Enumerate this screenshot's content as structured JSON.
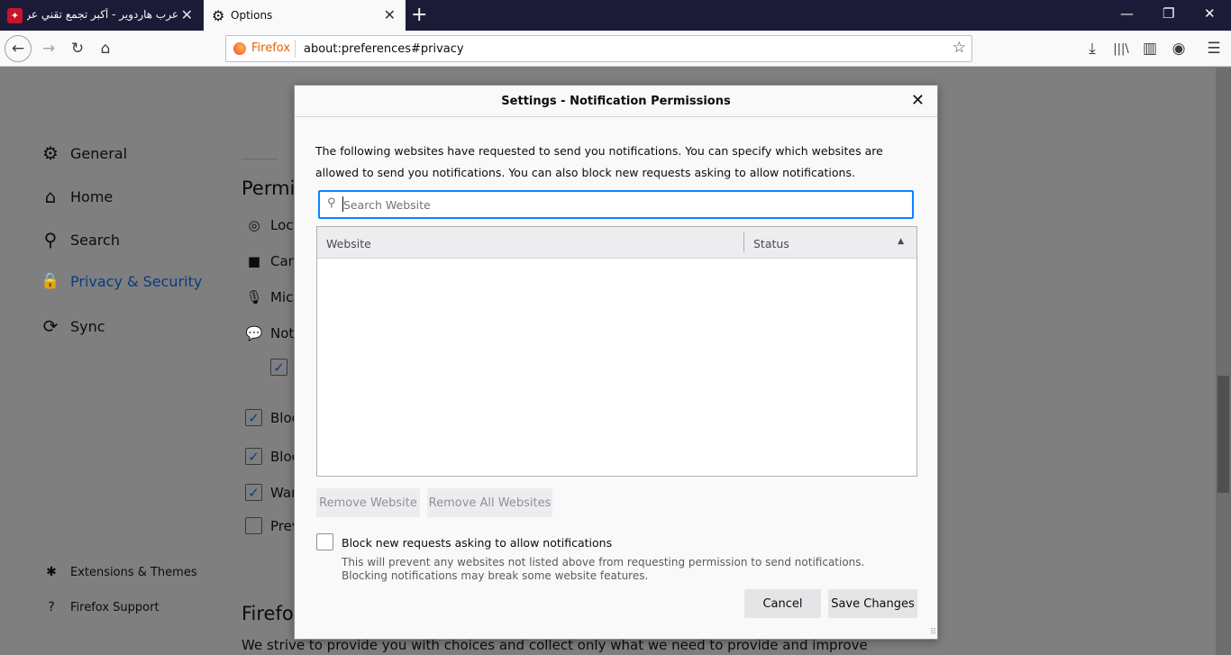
{
  "tabs": [
    {
      "title": "عرب هاردوير - أكبر تجمع تقني عربي",
      "favicon_glyph": "✦",
      "close": "✕"
    },
    {
      "title": "Options",
      "close": "✕"
    }
  ],
  "new_tab": "+",
  "window_controls": {
    "minimize": "—",
    "restore": "❐",
    "close": "✕"
  },
  "toolbar": {
    "back": "←",
    "forward": "→",
    "reload": "↻",
    "home": "⌂",
    "identity_label": "Firefox",
    "url": "about:preferences#privacy",
    "bookmark_star": "☆",
    "downloads": "⤓",
    "library": "|||\\",
    "sidebar": "▥",
    "account": "◉",
    "menu": "☰"
  },
  "sidebar": {
    "items": [
      {
        "label": "General",
        "icon": "⚙"
      },
      {
        "label": "Home",
        "icon": "⌂"
      },
      {
        "label": "Search",
        "icon": "⚲"
      },
      {
        "label": "Privacy & Security",
        "icon": "🔒"
      },
      {
        "label": "Sync",
        "icon": "⟳"
      }
    ],
    "footer": [
      {
        "label": "Extensions & Themes",
        "icon": "✱"
      },
      {
        "label": "Firefox Support",
        "icon": "?"
      }
    ]
  },
  "background_page": {
    "section_heading": "Permis",
    "permissions": [
      {
        "label": "Loca",
        "icon": "◎"
      },
      {
        "label": "Cam",
        "icon": "■"
      },
      {
        "label": "Micr",
        "icon": "🎙"
      },
      {
        "label": "Noti",
        "icon": "💬"
      }
    ],
    "checkboxes": [
      {
        "label": "Bloc",
        "checked": true
      },
      {
        "label": "Bloc",
        "checked": true
      },
      {
        "label": "War",
        "checked": true
      },
      {
        "label": "Prev",
        "checked": false
      }
    ],
    "check_mark": "✓",
    "footer_heading": "Firefox",
    "footer_text": "We strive to provide you with choices and collect only what we need to provide and improve"
  },
  "dialog": {
    "title": "Settings - Notification Permissions",
    "close": "✕",
    "description": "The following websites have requested to send you notifications. You can specify which websites are allowed to send you notifications. You can also block new requests asking to allow notifications.",
    "search_placeholder": "Search Website",
    "search_icon": "⚲",
    "columns": {
      "website": "Website",
      "status": "Status",
      "sort_indicator": "▲"
    },
    "rows": [],
    "remove_website": "Remove Website",
    "remove_all": "Remove All Websites",
    "block_label": "Block new requests asking to allow notifications",
    "block_checked": false,
    "block_description": "This will prevent any websites not listed above from requesting permission to send notifications. Blocking notifications may break some website features.",
    "cancel": "Cancel",
    "save": "Save Changes",
    "grip": "⠿"
  }
}
